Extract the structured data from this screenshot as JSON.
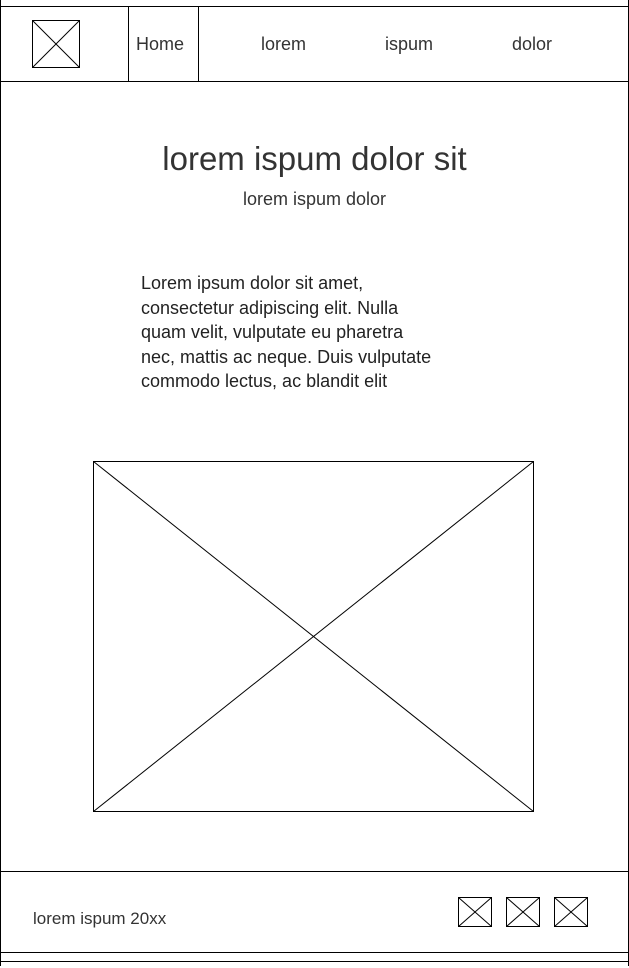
{
  "nav": {
    "logo_icon": "placeholder-image-icon",
    "items": [
      {
        "label": "Home",
        "active": true
      },
      {
        "label": "lorem",
        "active": false
      },
      {
        "label": "ispum",
        "active": false
      },
      {
        "label": "dolor",
        "active": false
      }
    ]
  },
  "hero": {
    "title": "lorem ispum dolor sit",
    "subtitle": "lorem ispum dolor"
  },
  "content": {
    "paragraph_lines": [
      "Lorem ipsum dolor sit amet,",
      "consectetur adipiscing elit. Nulla",
      "quam velit, vulputate eu pharetra",
      "nec, mattis ac neque. Duis vulputate",
      "commodo lectus, ac blandit elit"
    ],
    "image_icon": "placeholder-image-icon"
  },
  "footer": {
    "copyright": "lorem ispum 20xx",
    "social_icons": [
      "placeholder-icon",
      "placeholder-icon",
      "placeholder-icon"
    ]
  }
}
